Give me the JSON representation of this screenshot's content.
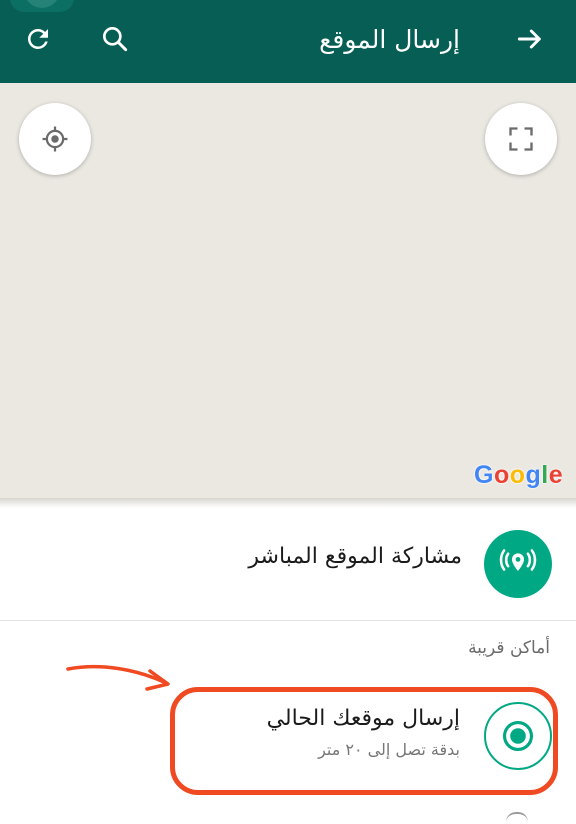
{
  "app_bar": {
    "title": "إرسال الموقع",
    "icons": {
      "back": "arrow-forward-icon",
      "search": "search-icon",
      "refresh": "refresh-icon"
    },
    "color": "#075e54"
  },
  "map": {
    "attribution": "Google",
    "buttons": {
      "locate": "my-location-icon",
      "fullscreen": "fullscreen-icon"
    },
    "background_color": "#ebe8e2"
  },
  "live_location": {
    "label": "مشاركة الموقع المباشر",
    "icon": "live-location-icon",
    "accent": "#00a884"
  },
  "nearby": {
    "section_title": "أماكن قريبة"
  },
  "current_location": {
    "title": "إرسال موقعك الحالي",
    "subtitle": "بدقة تصل إلى ٢٠ متر",
    "icon": "current-location-icon"
  },
  "annotation": {
    "color": "#f04a23"
  }
}
